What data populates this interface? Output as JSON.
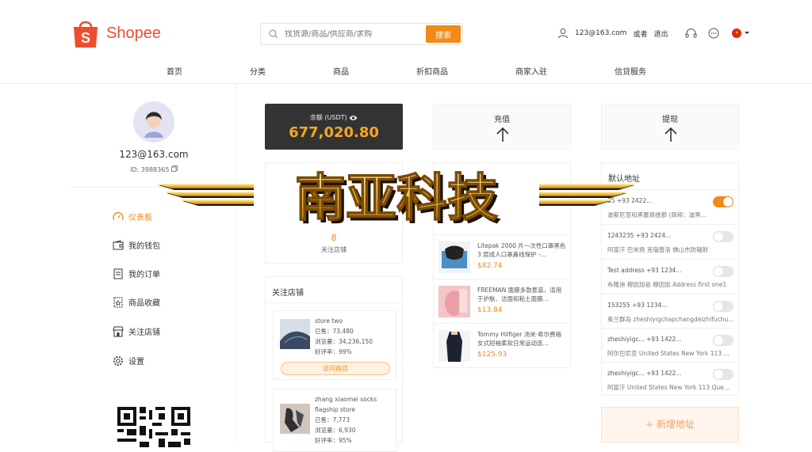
{
  "header": {
    "brand": "Shopee",
    "search_placeholder": "找货源/商品/供应商/求购",
    "search_button": "搜索",
    "user_email": "123@163.com",
    "or": "或者",
    "logout": "退出"
  },
  "nav": [
    "首页",
    "分类",
    "商品",
    "折扣商品",
    "商家入驻",
    "信贷服务"
  ],
  "sidebar": {
    "email": "123@163.com",
    "id_label": "ID: 3988365",
    "menu": [
      "仪表板",
      "我的钱包",
      "我的订单",
      "商品收藏",
      "关注店铺",
      "设置"
    ]
  },
  "balance": {
    "label": "余额 (USDT)",
    "value": "677,020.80"
  },
  "recharge": "充值",
  "withdraw": "提现",
  "follow_stat": {
    "count": "8",
    "label": "关注店铺"
  },
  "follow_box": {
    "title": "关注店铺",
    "shops": [
      {
        "name": "store two",
        "sold": "已售：73,480",
        "views": "浏览量：34,236,150",
        "rating": "好评率：99%",
        "visit": "访问商店"
      },
      {
        "name": "zhang xiaomei socks flagship store",
        "sold": "已售：7,773",
        "views": "浏览量：6,930",
        "rating": "好评率：95%"
      }
    ]
  },
  "products": [
    {
      "name": "Litepak 2000 片一次性口罩黑色 3 层成人口罩鼻线保护 -...",
      "price": "$82.74"
    },
    {
      "name": "FREEMAN 面膜多款套装，适用于护肤、洁面和粘土面膜...",
      "price": "$13.84"
    },
    {
      "name": "Tommy Hilfiger 汤米·希尔费格 女式短袖柔软日常运动连...",
      "price": "$125.93"
    }
  ],
  "address": {
    "title": "默认地址",
    "rows": [
      {
        "l1": "35  +93 2422...",
        "l2": "波斯尼亚和黑塞哥维那 (简称：波黑...",
        "on": true
      },
      {
        "l1": "1243235  +93 2424...",
        "l2": "阿富汗 巴米扬 克瑙普洛 佛山市防辐射",
        "on": false
      },
      {
        "l1": "Test address  +93 1234...",
        "l2": "布隆迪 穆因加省 穆因加 Address first one1",
        "on": false
      },
      {
        "l1": "153255  +93 1234...",
        "l2": "奥兰群岛 zheshiyigchapchangdeizhifuchu...",
        "on": false
      },
      {
        "l1": "zheshiyigc...  +93 1422...",
        "l2": "阿尔巴尼亚 United States New York 113 ...",
        "on": false
      },
      {
        "l1": "zheshiyigc...  +93 1422...",
        "l2": "阿富汗 United States New York 113 Que...",
        "on": false
      }
    ],
    "add_label": "+ 新增地址"
  },
  "watermark_text": "南亚科技",
  "colors": {
    "accent": "#f18a16",
    "brand": "#ee4d2d"
  }
}
